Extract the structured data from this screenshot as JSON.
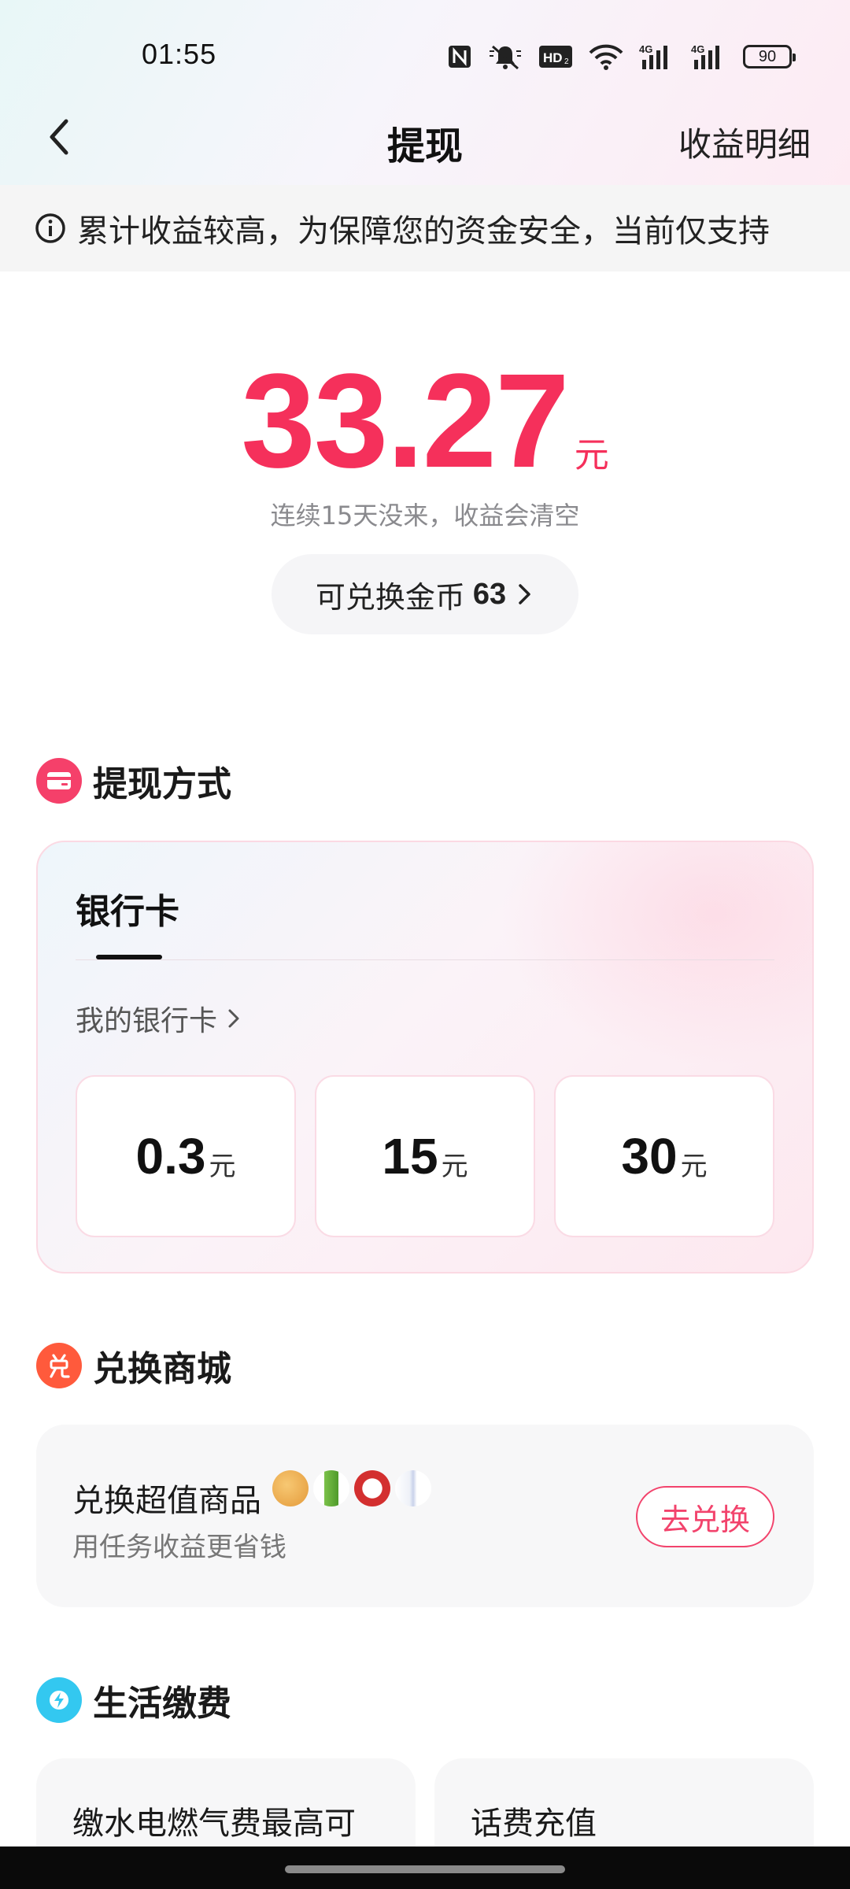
{
  "status_bar": {
    "time": "01:55",
    "battery": "90",
    "icons": [
      "nfc-icon",
      "mute-bell-icon",
      "hd-icon",
      "wifi-icon",
      "signal-4g-icon",
      "signal-4g-icon"
    ]
  },
  "nav": {
    "title": "提现",
    "right_link": "收益明细"
  },
  "notice": {
    "text": "累计收益较高，为保障您的资金安全，当前仅支持"
  },
  "balance": {
    "amount": "33.27",
    "unit": "元",
    "note": "连续15天没来，收益会清空",
    "coin_label": "可兑换金币",
    "coin_count": "63"
  },
  "withdraw_section": {
    "title": "提现方式",
    "tab": "银行卡",
    "my_card": "我的银行卡",
    "options": [
      {
        "value": "0.3",
        "unit": "元"
      },
      {
        "value": "15",
        "unit": "元"
      },
      {
        "value": "30",
        "unit": "元"
      }
    ]
  },
  "exchange_section": {
    "title": "兑换商城",
    "item_title": "兑换超值商品",
    "item_sub": "用任务收益更省钱",
    "button": "去兑换"
  },
  "life_section": {
    "title": "生活缴费",
    "cards": [
      "缴水电燃气费最高可",
      "话费充值"
    ]
  },
  "colors": {
    "accent": "#f5305b",
    "withdraw_icon": "#f5406a",
    "exchange_icon": "#ff5a3c",
    "life_icon": "#33c8f0"
  }
}
